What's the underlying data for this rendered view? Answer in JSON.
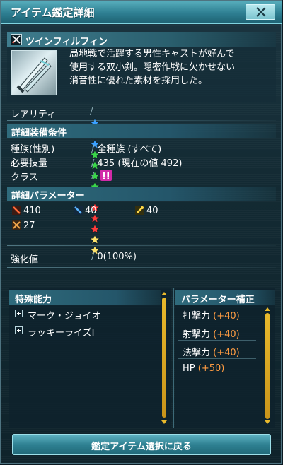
{
  "window": {
    "title": "アイテム鑑定詳細"
  },
  "item": {
    "name": "ツインフィルフィン",
    "category_icon": "twin-daggers-icon",
    "description_lines": [
      "局地戦で活躍する男性キャストが好んで",
      "使用する双小剣。隠密作戦に欠かせない",
      "消音性に優れた素材を採用した。"
    ]
  },
  "rarity": {
    "label": "レアリティ",
    "stars": 13,
    "star_colors": [
      "#3aa0ff",
      "#3aa0ff",
      "#3aa0ff",
      "#3ad64a",
      "#3ad64a",
      "#3ad64a",
      "#3ad64a",
      "#ff3b3b",
      "#ff3b3b",
      "#ff3b3b",
      "#ff3b3b",
      "#ffe46a",
      "#ffe46a"
    ]
  },
  "requirements": {
    "header": "詳細装備条件",
    "race_label": "種族(性別)",
    "race_value": "全種族 (すべて)",
    "skill_label": "必要技量",
    "skill_value": "435 (現在の値 492)",
    "class_label": "クラス",
    "class_value_icon": "warning-icon"
  },
  "parameters": {
    "header": "詳細パラメーター",
    "stats": [
      {
        "icon": "striking-icon",
        "value": "410"
      },
      {
        "icon": "ranged-icon",
        "value": "40"
      },
      {
        "icon": "technique-icon",
        "value": "40"
      },
      {
        "icon": "dex-icon",
        "value": "27"
      }
    ]
  },
  "grind": {
    "label": "強化値",
    "value": "0(100%)"
  },
  "abilities": {
    "header": "特殊能力",
    "items": [
      "マーク・ジョイオ",
      "ラッキーライズI"
    ]
  },
  "bonus": {
    "header": "パラメーター補正",
    "items": [
      {
        "label": "打撃力",
        "value": "(+40)"
      },
      {
        "label": "射撃力",
        "value": "(+40)"
      },
      {
        "label": "法撃力",
        "value": "(+40)"
      },
      {
        "label": "HP",
        "value": "(+50)"
      }
    ]
  },
  "footer": {
    "button_label": "鑑定アイテム選択に戻る"
  },
  "colors": {
    "accent": "#2f8192",
    "bonus_value": "#ff9c42",
    "scroll": "#e8b92c"
  }
}
